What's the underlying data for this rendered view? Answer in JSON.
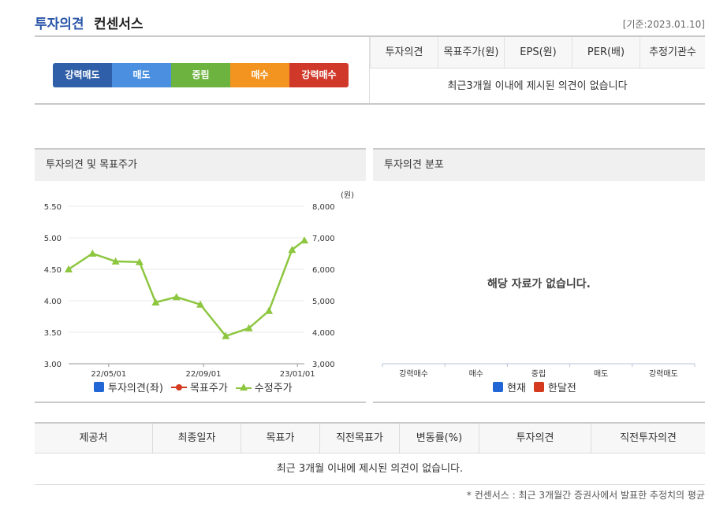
{
  "header": {
    "title_accent": "투자의견",
    "title_main": "컨센서스",
    "date": "[기준:2023.01.10]"
  },
  "rating_scale": [
    {
      "label": "강력매도",
      "color": "#2f5fa8"
    },
    {
      "label": "매도",
      "color": "#4a8fe0"
    },
    {
      "label": "중립",
      "color": "#6db33f"
    },
    {
      "label": "매수",
      "color": "#f39420"
    },
    {
      "label": "강력매수",
      "color": "#d0392a"
    }
  ],
  "summary": {
    "columns": [
      "투자의견",
      "목표주가(원)",
      "EPS(원)",
      "PER(배)",
      "추정기관수"
    ],
    "message": "최근3개월 이내에 제시된 의견이 없습니다"
  },
  "panel_left": {
    "title": "투자의견 및 목표주가"
  },
  "panel_right": {
    "title": "투자의견 분포",
    "no_data": "해당 자료가 없습니다."
  },
  "chart_data": [
    {
      "type": "line",
      "title": "투자의견 및 목표주가",
      "y_left_ticks": [
        "5.50",
        "5.00",
        "4.50",
        "4.00",
        "3.50",
        "3.00"
      ],
      "y_left_range": [
        3.0,
        5.5
      ],
      "y_right_unit": "(원)",
      "y_right_ticks": [
        "8,000",
        "7,000",
        "6,000",
        "5,000",
        "4,000",
        "3,000"
      ],
      "y_right_range": [
        3000,
        8000
      ],
      "x_ticks": [
        "22/05/01",
        "22/09/01",
        "23/01/01"
      ],
      "x_range": [
        "2022-03-10",
        "2023-01-10"
      ],
      "series": [
        {
          "name": "투자의견(좌)",
          "color": "#2166d4",
          "points": []
        },
        {
          "name": "목표주가",
          "color": "#d43a1f",
          "points": []
        },
        {
          "name": "수정주가",
          "color": "#8dc63f",
          "points": [
            {
              "x": "2022-03-10",
              "y": 6000
            },
            {
              "x": "2022-04-10",
              "y": 6500
            },
            {
              "x": "2022-05-10",
              "y": 6250
            },
            {
              "x": "2022-06-10",
              "y": 6230
            },
            {
              "x": "2022-07-01",
              "y": 4950
            },
            {
              "x": "2022-07-28",
              "y": 5120
            },
            {
              "x": "2022-08-28",
              "y": 4880
            },
            {
              "x": "2022-09-30",
              "y": 3880
            },
            {
              "x": "2022-10-30",
              "y": 4130
            },
            {
              "x": "2022-11-25",
              "y": 4680
            },
            {
              "x": "2022-12-25",
              "y": 6620
            },
            {
              "x": "2023-01-10",
              "y": 6920
            }
          ]
        }
      ],
      "legend": [
        "투자의견(좌)",
        "목표주가",
        "수정주가"
      ]
    },
    {
      "type": "bar",
      "title": "투자의견 분포",
      "categories": [
        "강력매수",
        "매수",
        "중립",
        "매도",
        "강력매도"
      ],
      "series": [
        {
          "name": "현재",
          "color": "#2166d4",
          "values": []
        },
        {
          "name": "한달전",
          "color": "#d43a1f",
          "values": []
        }
      ],
      "legend": [
        "현재",
        "한달전"
      ]
    }
  ],
  "table": {
    "columns": [
      "제공처",
      "최종일자",
      "목표가",
      "직전목표가",
      "변동률(%)",
      "투자의견",
      "직전투자의견"
    ],
    "message": "최근 3개월 이내에 제시된 의견이 없습니다."
  },
  "footnote": "* 컨센서스 : 최근 3개월간 증권사에서 발표한 추정치의 평균"
}
